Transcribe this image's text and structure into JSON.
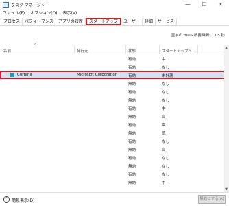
{
  "window": {
    "title": "タスク マネージャー",
    "buttons": {
      "minimize": "—",
      "maximize": "☐",
      "close": "✕"
    }
  },
  "menu": [
    "ファイル(F)",
    "オプション(O)",
    "表示(V)"
  ],
  "tabs": [
    {
      "label": "プロセス",
      "active": false
    },
    {
      "label": "パフォーマンス",
      "active": false
    },
    {
      "label": "アプリの履歴",
      "active": false
    },
    {
      "label": "スタートアップ",
      "active": true
    },
    {
      "label": "ユーザー",
      "active": false
    },
    {
      "label": "詳細",
      "active": false
    },
    {
      "label": "サービス",
      "active": false
    }
  ],
  "boot_info": "直前の BIOS 所要時間:   13.5 秒",
  "table": {
    "columns": [
      "名前",
      "発行元",
      "状態",
      "スタートアップへ..."
    ],
    "rows": [
      {
        "name": "",
        "publisher": "",
        "status": "有効",
        "impact": "中"
      },
      {
        "name": "",
        "publisher": "",
        "status": "有効",
        "impact": "なし"
      },
      {
        "name": "Cortana",
        "publisher": "Microsoft Corporation",
        "status": "有効",
        "impact": "未計測",
        "selected": true
      },
      {
        "name": "",
        "publisher": "",
        "status": "無効",
        "impact": "なし"
      },
      {
        "name": "",
        "publisher": "",
        "status": "有効",
        "impact": "なし"
      },
      {
        "name": "",
        "publisher": "",
        "status": "無効",
        "impact": "なし"
      },
      {
        "name": "",
        "publisher": "",
        "status": "有効",
        "impact": "中"
      },
      {
        "name": "",
        "publisher": "",
        "status": "無効",
        "impact": "高"
      },
      {
        "name": "",
        "publisher": "",
        "status": "有効",
        "impact": "高"
      },
      {
        "name": "",
        "publisher": "",
        "status": "無効",
        "impact": "低"
      },
      {
        "name": "",
        "publisher": "",
        "status": "有効",
        "impact": "なし"
      },
      {
        "name": "",
        "publisher": "",
        "status": "無効",
        "impact": "高"
      },
      {
        "name": "",
        "publisher": "",
        "status": "有効",
        "impact": "なし"
      },
      {
        "name": "",
        "publisher": "",
        "status": "無効",
        "impact": "なし"
      },
      {
        "name": "",
        "publisher": "",
        "status": "有効",
        "impact": "なし"
      },
      {
        "name": "",
        "publisher": "",
        "status": "無効",
        "impact": "中"
      }
    ]
  },
  "footer": {
    "collapse_label": "簡易表示(D)",
    "collapse_icon": "^",
    "disable_button": "無効にする(A)"
  }
}
